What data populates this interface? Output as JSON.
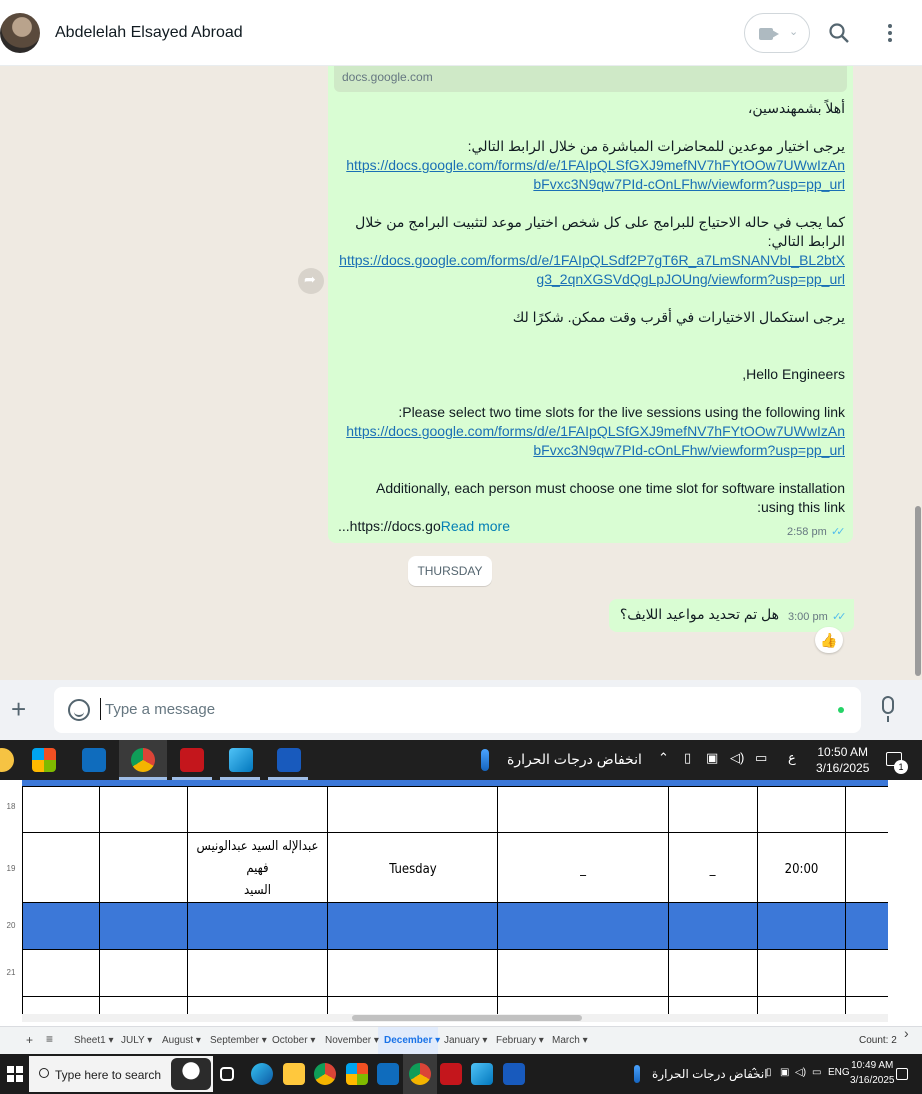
{
  "whatsapp": {
    "contact_name": "Abdelelah Elsayed Abroad",
    "link_preview_domain": "docs.google.com",
    "message1": {
      "greeting_ar": "أهلاً بشمهندسين،",
      "line_ar_1": "يرجى اختيار موعدين للمحاضرات المباشرة من خلال الرابط التالي:",
      "link_1a": "https://docs.google.com/forms/d/e/1FAIpQLSfGXJ9mefNV7hFYtOOw7UWwIzAn",
      "link_1b": "bFvxc3N9qw7PId-cOnLFhw/viewform?usp=pp_url",
      "line_ar_2a": "كما يجب في حاله الاحتياج للبرامج على كل شخص اختيار موعد لتثبيت  البرامج من خلال",
      "line_ar_2b": "الرابط التالي:",
      "link_2a": "https://docs.google.com/forms/d/e/1FAIpQLSdf2P7gT6R_a7LmSNANVbI_BL2btX",
      "link_2b": "g3_2qnXGSVdQgLpJOUng/viewform?usp=pp_url",
      "line_ar_3": "يرجى استكمال الاختيارات في أقرب وقت ممكن. شكرًا لك",
      "greeting_en": "Hello Engineers,",
      "line_en_1": "Please select two time slots for the live sessions using the following link:",
      "link_3a": "https://docs.google.com/forms/d/e/1FAIpQLSfGXJ9mefNV7hFYtOOw7UWwIzAn",
      "link_3b": "bFvxc3N9qw7PId-cOnLFhw/viewform?usp=pp_url",
      "line_en_2a": "Additionally, each person must choose one time slot for software installation",
      "line_en_2b": "using this link:",
      "truncated": "https://docs.go...",
      "read_more": "Read more",
      "time": "2:58 pm"
    },
    "day_divider": "THURSDAY",
    "message2": {
      "text": "هل تم تحديد مواعيد اللايف؟",
      "time": "3:00 pm",
      "reaction": "👍"
    },
    "composer": {
      "placeholder": "Type a message"
    }
  },
  "taskbar_top": {
    "weather": "انخفاض درجات الحرارة",
    "input_lang": "ع",
    "time": "10:50 AM",
    "date": "3/16/2025",
    "notifications": "1"
  },
  "spreadsheet": {
    "row_numbers": [
      "18",
      "19",
      "20",
      "21"
    ],
    "row19": {
      "name_line1": "عبدالإله السيد عبدالونيس فهيم",
      "name_line2": "السيد",
      "day": "Tuesday",
      "col_e": "_",
      "col_f": "_",
      "time": "20:00"
    },
    "tabs": [
      "Sheet1",
      "JULY",
      "August",
      "September",
      "October",
      "November",
      "December",
      "January",
      "February",
      "March"
    ],
    "active_tab": "December",
    "status": "Count: 2"
  },
  "win_taskbar": {
    "search_placeholder": "Type here to search",
    "weather": "انخفاض درجات الحرارة",
    "lang": "ENG",
    "time": "10:49 AM",
    "date": "3/16/2025"
  }
}
